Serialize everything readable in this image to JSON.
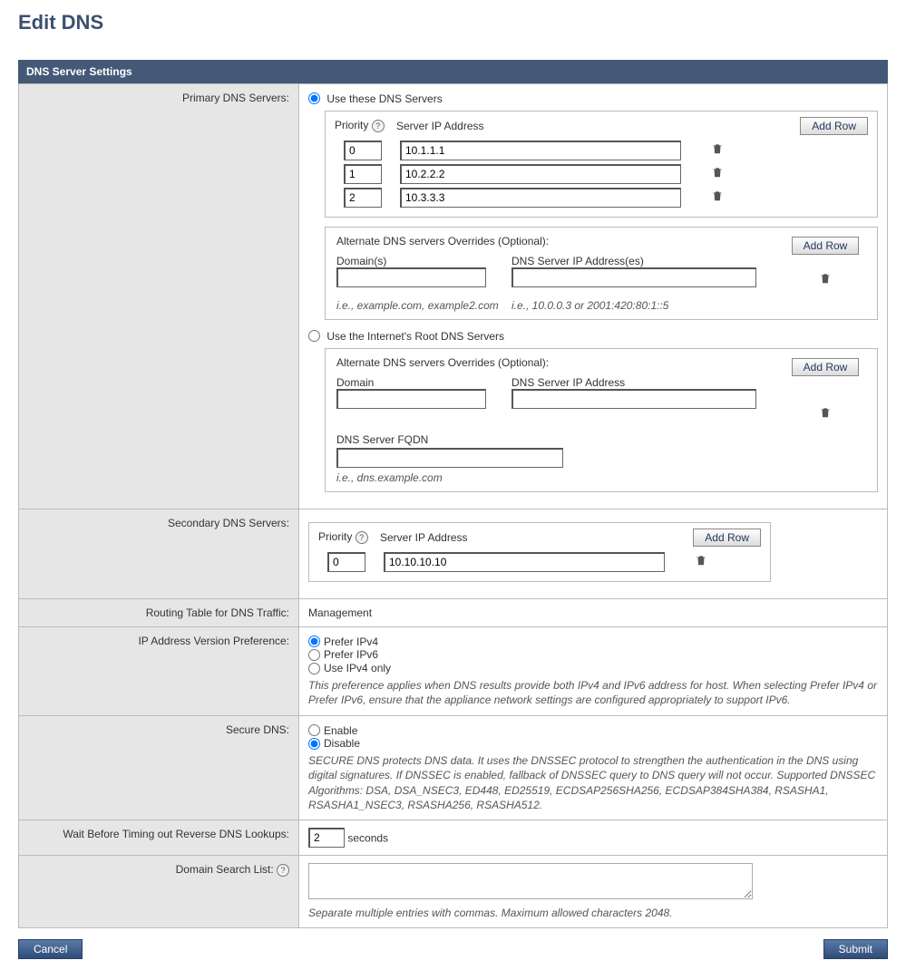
{
  "page_title": "Edit DNS",
  "panel_title": "DNS Server Settings",
  "primary": {
    "label": "Primary DNS Servers:",
    "option_use": "Use these DNS Servers",
    "option_root": "Use the Internet's Root DNS Servers",
    "cols": {
      "priority": "Priority",
      "ip": "Server IP Address"
    },
    "add_row": "Add Row",
    "rows": [
      {
        "priority": "0",
        "ip": "10.1.1.1"
      },
      {
        "priority": "1",
        "ip": "10.2.2.2"
      },
      {
        "priority": "2",
        "ip": "10.3.3.3"
      }
    ],
    "alt": {
      "title": "Alternate DNS servers Overrides (Optional):",
      "domain_label": "Domain(s)",
      "ip_label": "DNS Server IP Address(es)",
      "domain_val": "",
      "ip_val": "",
      "hint_domain": "i.e., example.com, example2.com",
      "hint_ip": "i.e., 10.0.0.3 or 2001:420:80:1::5",
      "add_row": "Add Row"
    },
    "root_alt": {
      "title": "Alternate DNS servers Overrides (Optional):",
      "domain_label": "Domain",
      "ip_label": "DNS Server IP Address",
      "fqdn_label": "DNS Server FQDN",
      "domain_val": "",
      "ip_val": "",
      "fqdn_val": "",
      "hint_fqdn": "i.e., dns.example.com",
      "add_row": "Add Row"
    }
  },
  "secondary": {
    "label": "Secondary DNS Servers:",
    "cols": {
      "priority": "Priority",
      "ip": "Server IP Address"
    },
    "add_row": "Add Row",
    "rows": [
      {
        "priority": "0",
        "ip": "10.10.10.10"
      }
    ]
  },
  "routing": {
    "label": "Routing Table for DNS Traffic:",
    "value": "Management"
  },
  "ip_pref": {
    "label": "IP Address Version Preference:",
    "opt4": "Prefer IPv4",
    "opt6": "Prefer IPv6",
    "opt4only": "Use IPv4 only",
    "desc": "This preference applies when DNS results provide both IPv4 and IPv6 address for host. When selecting Prefer IPv4 or Prefer IPv6, ensure that the appliance network settings are configured appropriately to support IPv6."
  },
  "secure_dns": {
    "label": "Secure DNS:",
    "enable": "Enable",
    "disable": "Disable",
    "desc": "SECURE DNS protects DNS data. It uses the DNSSEC protocol to strengthen the authentication in the DNS using digital signatures. If DNSSEC is enabled, fallback of DNSSEC query to DNS query will not occur. Supported DNSSEC Algorithms: DSA, DSA_NSEC3, ED448, ED25519, ECDSAP256SHA256, ECDSAP384SHA384, RSASHA1, RSASHA1_NSEC3, RSASHA256, RSASHA512."
  },
  "wait": {
    "label": "Wait Before Timing out Reverse DNS Lookups:",
    "value": "2",
    "unit": "seconds"
  },
  "dsl": {
    "label": "Domain Search List:",
    "value": "",
    "hint": "Separate multiple entries with commas. Maximum allowed characters 2048."
  },
  "buttons": {
    "cancel": "Cancel",
    "submit": "Submit"
  },
  "help": "?"
}
